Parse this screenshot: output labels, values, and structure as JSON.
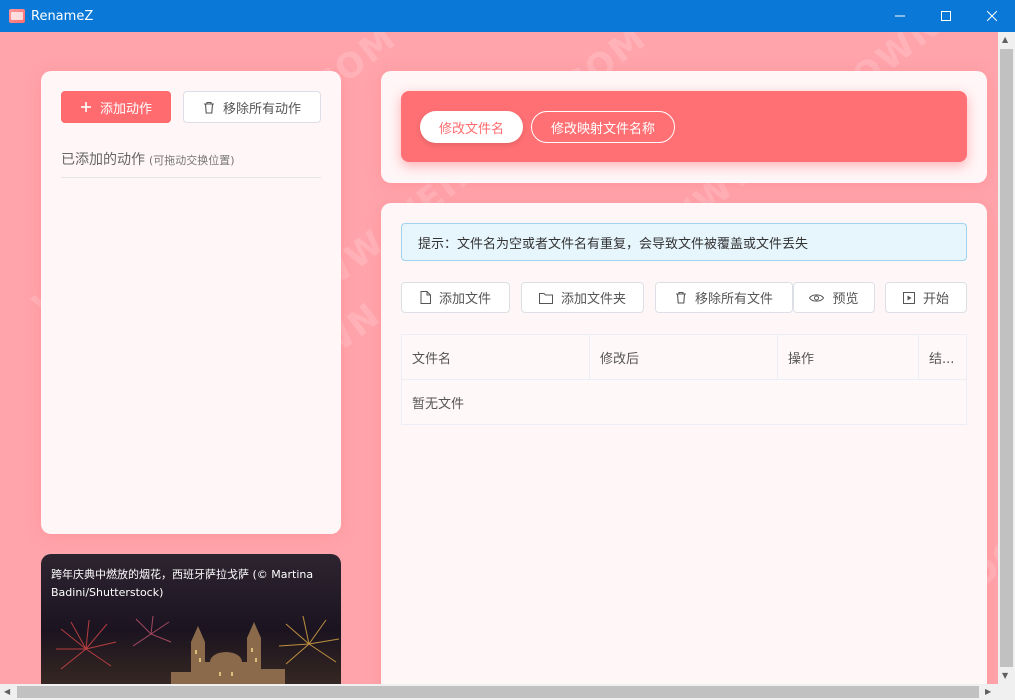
{
  "window": {
    "title": "RenameZ"
  },
  "actions": {
    "add_label": "添加动作",
    "remove_all_label": "移除所有动作",
    "added_title": "已添加的动作",
    "added_hint": "(可拖动交换位置)"
  },
  "image_card": {
    "caption": "跨年庆典中燃放的烟花，西班牙萨拉戈萨 (© Martina Badini/Shutterstock)"
  },
  "tabs": [
    {
      "label": "修改文件名",
      "active": true
    },
    {
      "label": "修改映射文件名称",
      "active": false
    }
  ],
  "tip": "提示：文件名为空或者文件名有重复，会导致文件被覆盖或文件丢失",
  "toolbar": {
    "add_file": "添加文件",
    "add_folder": "添加文件夹",
    "remove_all_files": "移除所有文件",
    "preview": "预览",
    "start": "开始"
  },
  "table": {
    "columns": [
      "文件名",
      "修改后",
      "操作",
      "结..."
    ],
    "empty_text": "暂无文件"
  },
  "watermark": "WWW.WEIDOWN.COM",
  "colors": {
    "titlebar": "#0a78d7",
    "background": "#ffa4ab",
    "accent": "#ff6b6f",
    "panel": "#fff6f7"
  }
}
